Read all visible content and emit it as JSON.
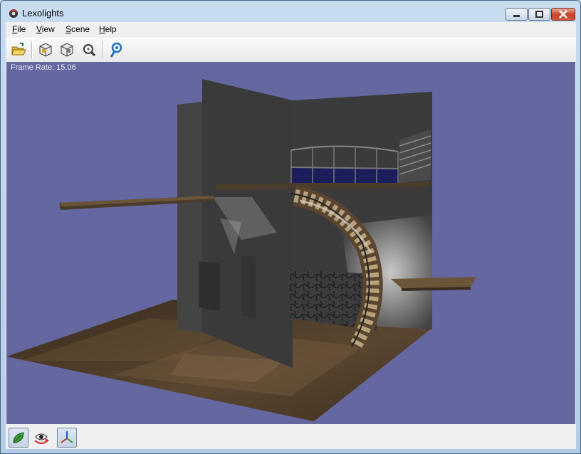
{
  "window": {
    "title": "Lexolights"
  },
  "menu": {
    "file": "File",
    "view": "View",
    "scene": "Scene",
    "help": "Help"
  },
  "toolbar": {
    "icons": [
      "open-folder-icon",
      "scene-box-1-icon",
      "scene-box-2-icon",
      "zoom-icon",
      "pick-icon"
    ]
  },
  "viewport": {
    "frame_rate_label": "Frame Rate: 15.06"
  },
  "statusbar": {
    "icons": [
      "leaf-icon",
      "eye-rotate-icon",
      "axes-icon"
    ]
  },
  "colors": {
    "viewport_bg": "#6567a0",
    "floor": "#4a3a28",
    "wall": "#3b3b3b"
  }
}
